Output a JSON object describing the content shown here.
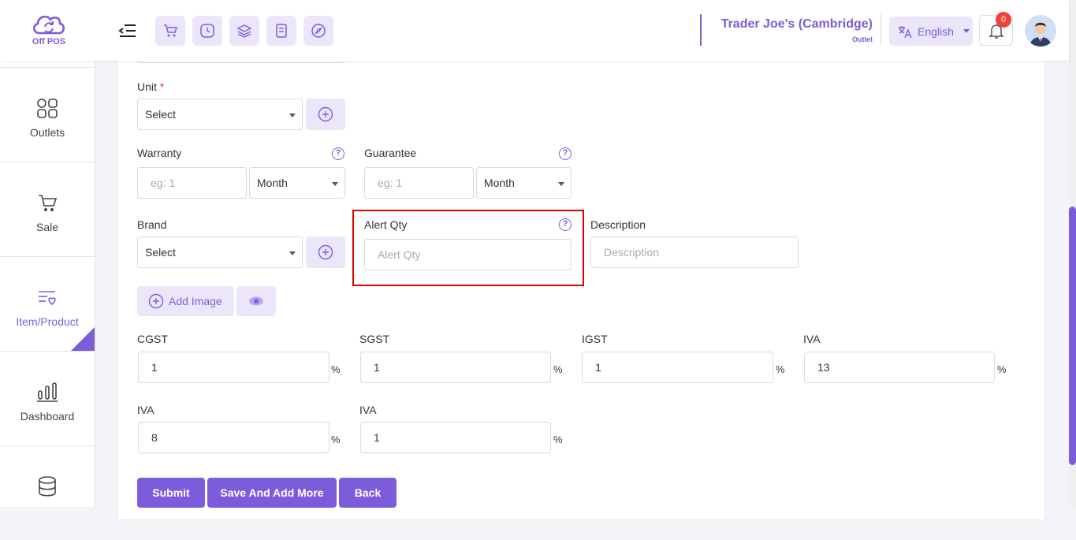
{
  "header": {
    "logo_text": "Off POS",
    "outlet_name": "Trader Joe's (Cambridge)",
    "outlet_sub": "Outlet",
    "language": "English",
    "notification_count": "0",
    "quick_icons": [
      "cart-icon",
      "clock-icon",
      "layers-icon",
      "receipt-icon",
      "compass-icon"
    ]
  },
  "sidebar": {
    "items": [
      {
        "label": "Outlets",
        "icon": "outlets-icon"
      },
      {
        "label": "Sale",
        "icon": "sale-cart-icon"
      },
      {
        "label": "Item/Product",
        "icon": "item-product-icon",
        "active": true
      },
      {
        "label": "Dashboard",
        "icon": "dashboard-chart-icon"
      },
      {
        "label": "",
        "icon": "database-icon"
      }
    ]
  },
  "form": {
    "unit": {
      "label": "Unit",
      "required": "*",
      "value": "Select"
    },
    "warranty": {
      "label": "Warranty",
      "placeholder": "eg: 1",
      "period": "Month"
    },
    "guarantee": {
      "label": "Guarantee",
      "placeholder": "eg: 1",
      "period": "Month"
    },
    "brand": {
      "label": "Brand",
      "value": "Select"
    },
    "alert_qty": {
      "label": "Alert Qty",
      "placeholder": "Alert Qty"
    },
    "description": {
      "label": "Description",
      "placeholder": "Description"
    },
    "add_image_label": "Add Image",
    "taxes_row1": [
      {
        "label": "CGST",
        "value": "1",
        "unit": "%"
      },
      {
        "label": "SGST",
        "value": "1",
        "unit": "%"
      },
      {
        "label": "IGST",
        "value": "1",
        "unit": "%"
      },
      {
        "label": "IVA",
        "value": "13",
        "unit": "%"
      }
    ],
    "taxes_row2": [
      {
        "label": "IVA",
        "value": "8",
        "unit": "%"
      },
      {
        "label": "IVA",
        "value": "1",
        "unit": "%"
      }
    ],
    "buttons": {
      "submit": "Submit",
      "save_add_more": "Save And Add More",
      "back": "Back"
    }
  },
  "colors": {
    "accent": "#7c5cdb",
    "accent_light": "#ece6fb",
    "highlight": "#e00000",
    "badge": "#f04438"
  }
}
